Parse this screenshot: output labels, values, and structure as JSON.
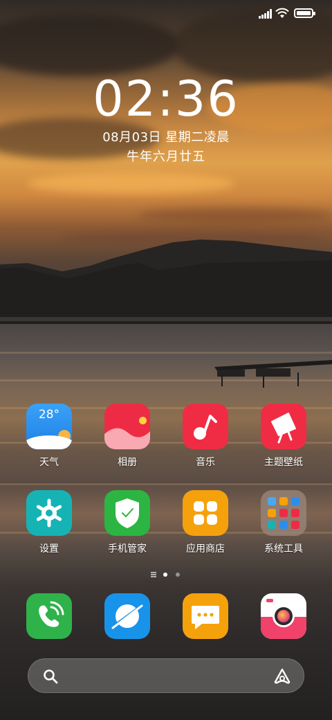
{
  "status_bar": {
    "icons": [
      "signal-icon",
      "wifi-icon",
      "battery-icon"
    ],
    "battery_level": 1.0
  },
  "lock": {
    "time": "02:36",
    "date": "08月03日 星期二凌晨",
    "lunar": "牛年六月廿五"
  },
  "apps": [
    {
      "label": "天气",
      "icon": "weather-icon",
      "temp": "28°",
      "color": "#2a8ef0"
    },
    {
      "label": "相册",
      "icon": "gallery-icon",
      "color": "#ee2b45"
    },
    {
      "label": "音乐",
      "icon": "music-icon",
      "color": "#f02c44"
    },
    {
      "label": "主题壁纸",
      "icon": "themes-icon",
      "color": "#f02c44"
    },
    {
      "label": "设置",
      "icon": "settings-icon",
      "color": "#16b3b5"
    },
    {
      "label": "手机管家",
      "icon": "security-icon",
      "color": "#2cb543"
    },
    {
      "label": "应用商店",
      "icon": "app-store-icon",
      "color": "#f5a10c"
    },
    {
      "label": "系统工具",
      "icon": "folder-icon",
      "color": "#8a7c72"
    }
  ],
  "dock": [
    {
      "icon": "phone-icon",
      "color": "#2fb24a"
    },
    {
      "icon": "browser-icon",
      "color": "#1893ea"
    },
    {
      "icon": "messages-icon",
      "color": "#f5a10c"
    },
    {
      "icon": "camera-icon",
      "color": "#f0426a"
    }
  ],
  "page_indicator": {
    "pages": 2,
    "current": 1
  },
  "search_bar": {
    "icons": [
      "search-icon",
      "assistant-icon"
    ]
  }
}
